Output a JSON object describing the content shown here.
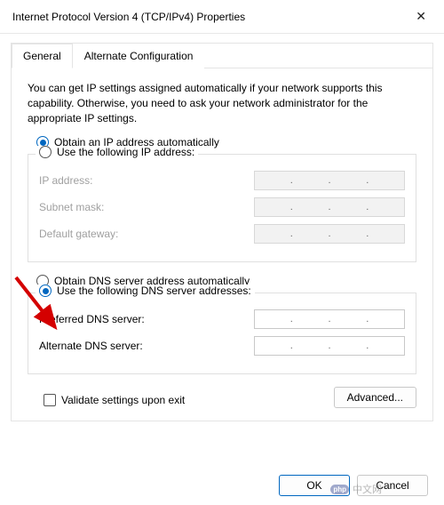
{
  "window": {
    "title": "Internet Protocol Version 4 (TCP/IPv4) Properties"
  },
  "tabs": {
    "general": "General",
    "alternate": "Alternate Configuration"
  },
  "description": "You can get IP settings assigned automatically if your network supports this capability. Otherwise, you need to ask your network administrator for the appropriate IP settings.",
  "ip_section": {
    "auto": "Obtain an IP address automatically",
    "manual": "Use the following IP address:",
    "ip_label": "IP address:",
    "subnet_label": "Subnet mask:",
    "gateway_label": "Default gateway:"
  },
  "dns_section": {
    "auto": "Obtain DNS server address automatically",
    "manual": "Use the following DNS server addresses:",
    "preferred_label": "Preferred DNS server:",
    "alternate_label": "Alternate DNS server:"
  },
  "validate_label": "Validate settings upon exit",
  "buttons": {
    "advanced": "Advanced...",
    "ok": "OK",
    "cancel": "Cancel"
  },
  "watermark": "中文网"
}
